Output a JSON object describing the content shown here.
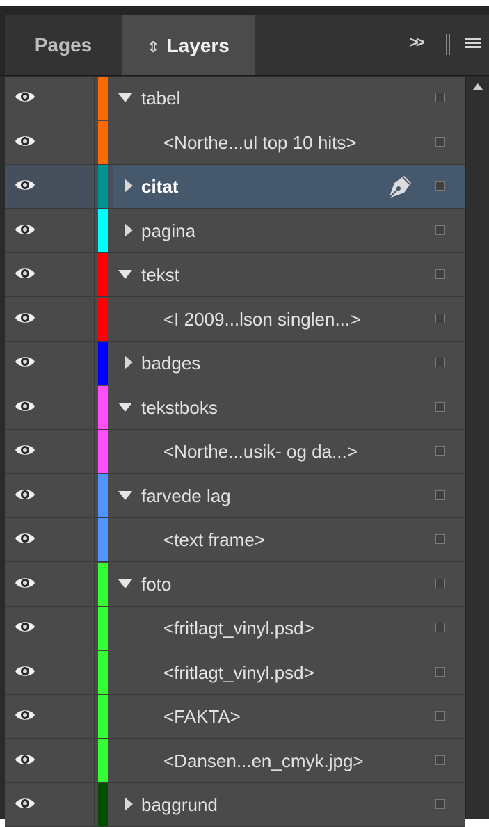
{
  "tabs": {
    "pages": "Pages",
    "layers": "Layers",
    "layers_sort_glyph": "⬍"
  },
  "controls": {
    "more_glyph": ">>",
    "menu_icon": "panel-menu-icon",
    "grip_icon": "panel-grip-icon"
  },
  "colors": {
    "panel_bg": "#4a4a4a",
    "selected_row_bg": "#46586c"
  },
  "layers": [
    {
      "label": "tabel",
      "level": 0,
      "state": "expanded",
      "color": "#ff6a00"
    },
    {
      "label": "<Northe...ul top 10 hits>",
      "level": 1,
      "state": "none",
      "color": "#ff6a00"
    },
    {
      "label": "citat",
      "level": 0,
      "state": "collapsed",
      "color": "#009191",
      "selected": true,
      "pen": true
    },
    {
      "label": "pagina",
      "level": 0,
      "state": "collapsed",
      "color": "#00ffff"
    },
    {
      "label": "tekst",
      "level": 0,
      "state": "expanded",
      "color": "#ff0000"
    },
    {
      "label": "<I 2009...lson singlen...>",
      "level": 1,
      "state": "none",
      "color": "#ff0000"
    },
    {
      "label": "badges",
      "level": 0,
      "state": "collapsed",
      "color": "#0000ff"
    },
    {
      "label": "tekstboks",
      "level": 0,
      "state": "expanded",
      "color": "#ff4dff"
    },
    {
      "label": "<Northe...usik- og da...>",
      "level": 1,
      "state": "none",
      "color": "#ff4dff"
    },
    {
      "label": "farvede lag",
      "level": 0,
      "state": "expanded",
      "color": "#4f94ff"
    },
    {
      "label": "<text frame>",
      "level": 1,
      "state": "none",
      "color": "#4f94ff"
    },
    {
      "label": "foto",
      "level": 0,
      "state": "expanded",
      "color": "#33ff33"
    },
    {
      "label": "<fritlagt_vinyl.psd>",
      "level": 1,
      "state": "none",
      "color": "#33ff33"
    },
    {
      "label": "<fritlagt_vinyl.psd>",
      "level": 1,
      "state": "none",
      "color": "#33ff33"
    },
    {
      "label": "<FAKTA>",
      "level": 1,
      "state": "none",
      "color": "#33ff33"
    },
    {
      "label": "<Dansen...en_cmyk.jpg>",
      "level": 1,
      "state": "none",
      "color": "#33ff33"
    },
    {
      "label": "baggrund",
      "level": 0,
      "state": "collapsed",
      "color": "#005000"
    }
  ]
}
